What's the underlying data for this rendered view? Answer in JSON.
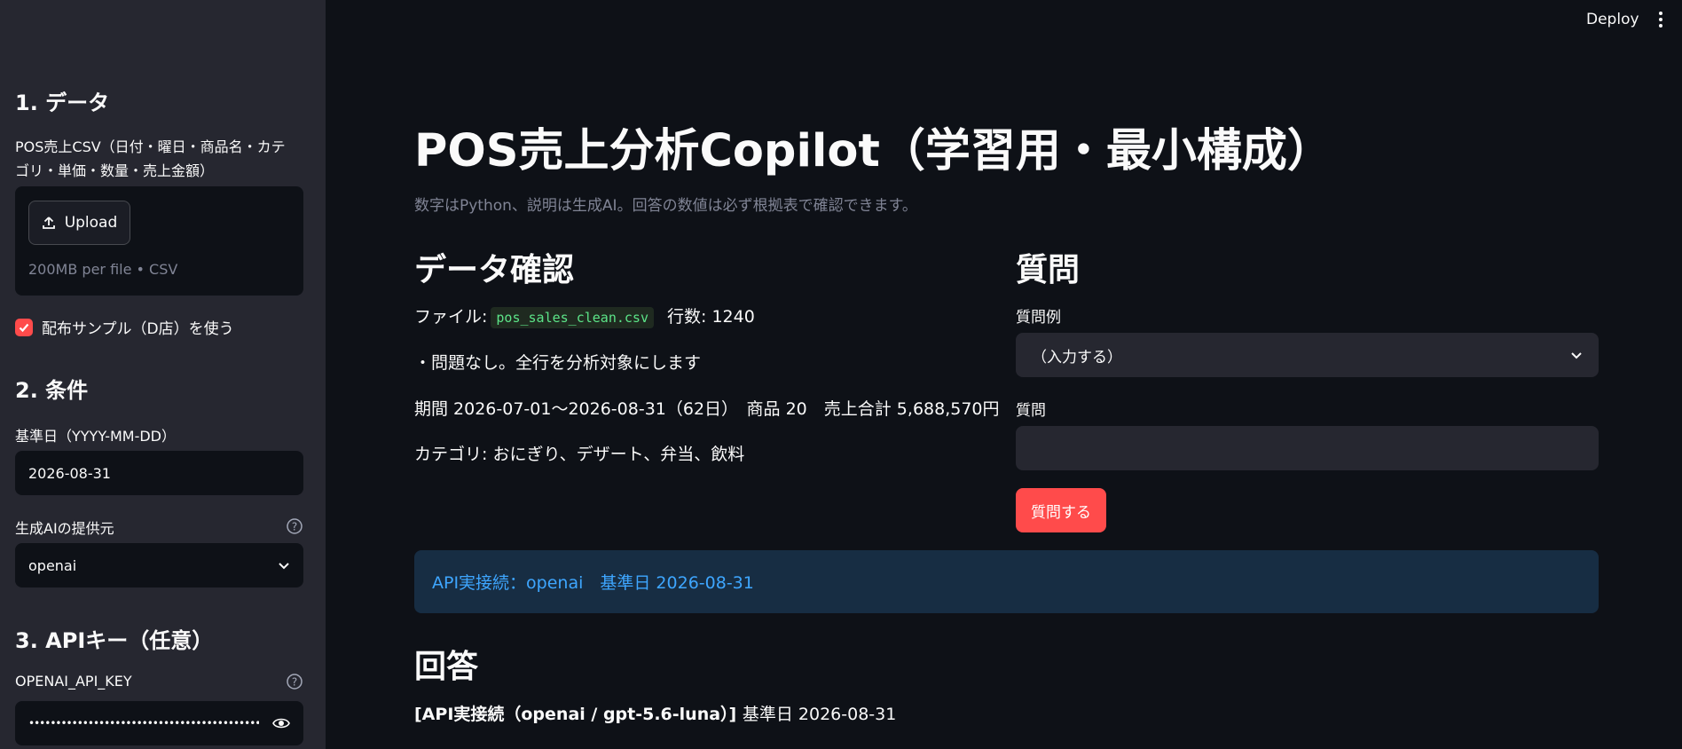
{
  "header": {
    "deploy_label": "Deploy"
  },
  "sidebar": {
    "section1": "1. データ",
    "csv_label": "POS売上CSV（日付・曜日・商品名・カテゴリ・単価・数量・売上金額）",
    "csv_label_line1": "POS売上CSV（日付・曜日・商品名・カテ",
    "csv_label_line2": "ゴリ・単価・数量・売上金額）",
    "upload_label": "Upload",
    "upload_hint": "200MB per file • CSV",
    "sample_checkbox_label": "配布サンプル（D店）を使う",
    "sample_checked": true,
    "section2": "2. 条件",
    "base_date_label": "基準日（YYYY-MM-DD）",
    "base_date_value": "2026-08-31",
    "provider_label": "生成AIの提供元",
    "provider_value": "openai",
    "section3": "3. APIキー（任意）",
    "api_key_label": "OPENAI_API_KEY",
    "api_key_value": "••••••••••••••••••••••••••••••••••••••••••••••••••••"
  },
  "main": {
    "title": "POS売上分析Copilot（学習用・最小構成）",
    "caption": "数字はPython、説明は生成AI。回答の数値は必ず根拠表で確認できます。",
    "data_section": {
      "heading": "データ確認",
      "file_label": "ファイル:",
      "file_name": "pos_sales_clean.csv",
      "rows_label": "行数: 1240",
      "status": "・問題なし。全行を分析対象にします",
      "summary": "期間 2026-07-01〜2026-08-31（62日）　商品 20　売上合計 5,688,570円",
      "categories": "カテゴリ: おにぎり、デザート、弁当、飲料"
    },
    "question_section": {
      "heading": "質問",
      "example_label": "質問例",
      "example_value": "（入力する）",
      "question_label": "質問",
      "question_value": "",
      "ask_button": "質問する"
    },
    "info_message": "API実接続：openai　基準日 2026-08-31",
    "answer_heading": "回答",
    "answer_bold": "[API実接続（openai / gpt-5.6-luna）]",
    "answer_plain": "基準日 2026-08-31"
  },
  "colors": {
    "accent": "#ff4b4b",
    "sidebar_bg": "#262730",
    "main_bg": "#0e1117",
    "info_bg": "#172d43",
    "info_text": "#3ea6ff",
    "code_text": "#5ce488"
  },
  "icons": [
    "upload-icon",
    "check-icon",
    "help-icon",
    "chevron-down-icon",
    "eye-icon",
    "kebab-menu-icon"
  ]
}
